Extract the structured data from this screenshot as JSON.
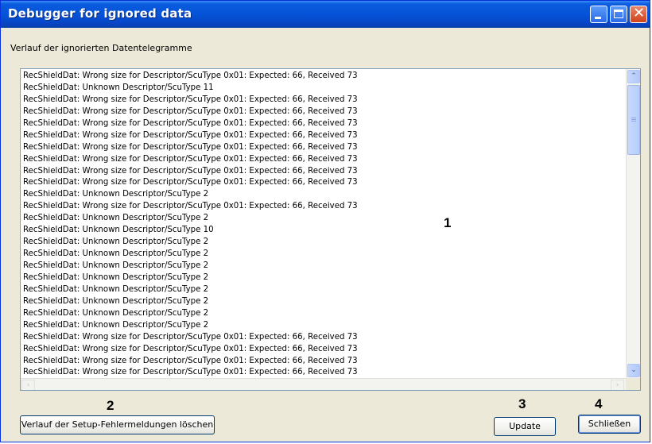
{
  "window": {
    "title": "Debugger for ignored data"
  },
  "titlebar_buttons": {
    "minimize_icon": "minimize-icon",
    "maximize_icon": "maximize-icon",
    "close_icon": "close-icon",
    "close_glyph": "✕"
  },
  "section_label": "Verlauf der ignorierten Datentelegramme",
  "log_lines": [
    "RecShieldDat: Wrong size for Descriptor/ScuType 0x01: Expected: 66,  Received 73",
    "RecShieldDat: Unknown Descriptor/ScuType 11",
    "RecShieldDat: Wrong size for Descriptor/ScuType 0x01: Expected: 66,  Received 73",
    "RecShieldDat: Wrong size for Descriptor/ScuType 0x01: Expected: 66,  Received 73",
    "RecShieldDat: Wrong size for Descriptor/ScuType 0x01: Expected: 66,  Received 73",
    "RecShieldDat: Wrong size for Descriptor/ScuType 0x01: Expected: 66,  Received 73",
    "RecShieldDat: Wrong size for Descriptor/ScuType 0x01: Expected: 66,  Received 73",
    "RecShieldDat: Wrong size for Descriptor/ScuType 0x01: Expected: 66,  Received 73",
    "RecShieldDat: Wrong size for Descriptor/ScuType 0x01: Expected: 66,  Received 73",
    "RecShieldDat: Wrong size for Descriptor/ScuType 0x01: Expected: 66,  Received 73",
    "RecShieldDat: Unknown Descriptor/ScuType 2",
    "RecShieldDat: Wrong size for Descriptor/ScuType 0x01: Expected: 66,  Received 73",
    "RecShieldDat: Unknown Descriptor/ScuType 2",
    "RecShieldDat: Unknown Descriptor/ScuType 10",
    "RecShieldDat: Unknown Descriptor/ScuType 2",
    "RecShieldDat: Unknown Descriptor/ScuType 2",
    "RecShieldDat: Unknown Descriptor/ScuType 2",
    "RecShieldDat: Unknown Descriptor/ScuType 2",
    "RecShieldDat: Unknown Descriptor/ScuType 2",
    "RecShieldDat: Unknown Descriptor/ScuType 2",
    "RecShieldDat: Unknown Descriptor/ScuType 2",
    "RecShieldDat: Unknown Descriptor/ScuType 2",
    "RecShieldDat: Wrong size for Descriptor/ScuType 0x01: Expected: 66,  Received 73",
    "RecShieldDat: Wrong size for Descriptor/ScuType 0x01: Expected: 66,  Received 73",
    "RecShieldDat: Wrong size for Descriptor/ScuType 0x01: Expected: 66,  Received 73",
    "RecShieldDat: Wrong size for Descriptor/ScuType 0x01: Expected: 66,  Received 73"
  ],
  "callouts": {
    "log": "1",
    "clear": "2",
    "update": "3",
    "close": "4"
  },
  "buttons": {
    "clear_label": "Verlauf der Setup-Fehlermeldungen löschen",
    "update_label": "Update",
    "close_label": "Schließen"
  },
  "scrollbar": {
    "up_glyph": "⌃",
    "down_glyph": "⌄",
    "left_glyph": "‹",
    "right_glyph": "›"
  },
  "colors": {
    "titlebar": "#0553d8",
    "window_bg": "#ece9d8",
    "close_button": "#d0421a"
  }
}
